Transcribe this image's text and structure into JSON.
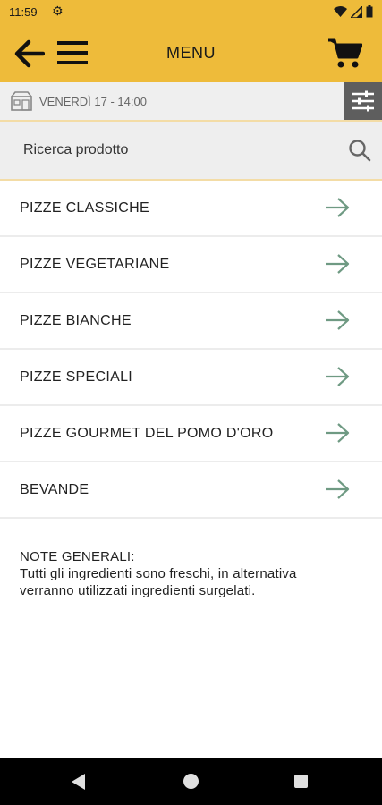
{
  "status_bar": {
    "time": "11:59",
    "icons": [
      "gear-icon",
      "wifi-icon",
      "signal-icon",
      "battery-icon"
    ]
  },
  "header": {
    "title": "MENU",
    "background": "#eebb3a",
    "icons": [
      "arrow-back-icon",
      "hamburger-menu-icon",
      "cart-icon"
    ]
  },
  "datebar": {
    "date_text": "VENERDÌ 17 - 14:00",
    "icons": [
      "calendar-shop-icon",
      "filter-sliders-icon"
    ]
  },
  "search": {
    "placeholder": "Ricerca prodotto",
    "icon": "search-icon"
  },
  "categories": [
    {
      "label": "PIZZE CLASSICHE"
    },
    {
      "label": "PIZZE VEGETARIANE"
    },
    {
      "label": "PIZZE BIANCHE"
    },
    {
      "label": "PIZZE SPECIALI"
    },
    {
      "label": "PIZZE GOURMET DEL POMO D'ORO"
    },
    {
      "label": "BEVANDE"
    }
  ],
  "arrow_color": "#6f9a83",
  "notes": {
    "heading": "NOTE GENERALI:",
    "line1": "Tutti gli ingredienti sono freschi, in alternativa",
    "line2": "verranno utilizzati ingredienti surgelati."
  },
  "system_nav": {
    "icons": [
      "nav-back-icon",
      "nav-home-icon",
      "nav-recents-icon"
    ]
  }
}
